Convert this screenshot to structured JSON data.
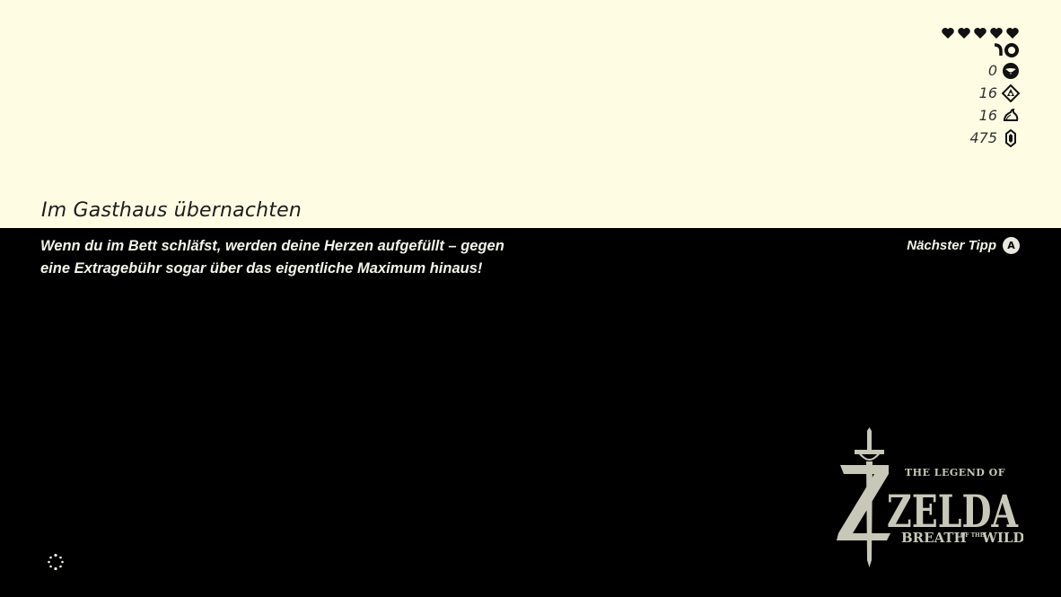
{
  "hud": {
    "hearts_icon": "heart-icon",
    "heart_count": 5,
    "stamina_icon": "stamina-wheel-icon",
    "stats": [
      {
        "name": "korok-seed-counter",
        "icon": "korok-leaf-icon",
        "value": "0"
      },
      {
        "name": "spirit-orb-counter",
        "icon": "spirit-orb-icon",
        "value": "16"
      },
      {
        "name": "amiibo-or-special-counter",
        "icon": "droplet-icon",
        "value": "16"
      },
      {
        "name": "rupee-counter",
        "icon": "rupee-icon",
        "value": "475"
      }
    ]
  },
  "tip": {
    "title": "Im Gasthaus übernachten",
    "body_line1": "Wenn du im Bett schläfst, werden deine Herzen aufgefüllt – gegen",
    "body_line2": "eine Extragebühr sogar über das eigentliche Maximum hinaus!",
    "next_label": "Nächster Tipp",
    "next_button": "A"
  },
  "logo": {
    "line1": "THE LEGEND OF",
    "line2": "ZELDA",
    "line3": "BREATH",
    "line3b": "OF THE",
    "line4": "WILD"
  },
  "colors": {
    "top_band": "#fefde4",
    "background": "#000000",
    "text_light": "#f4f4ea",
    "logo": "#c8c8b8"
  }
}
